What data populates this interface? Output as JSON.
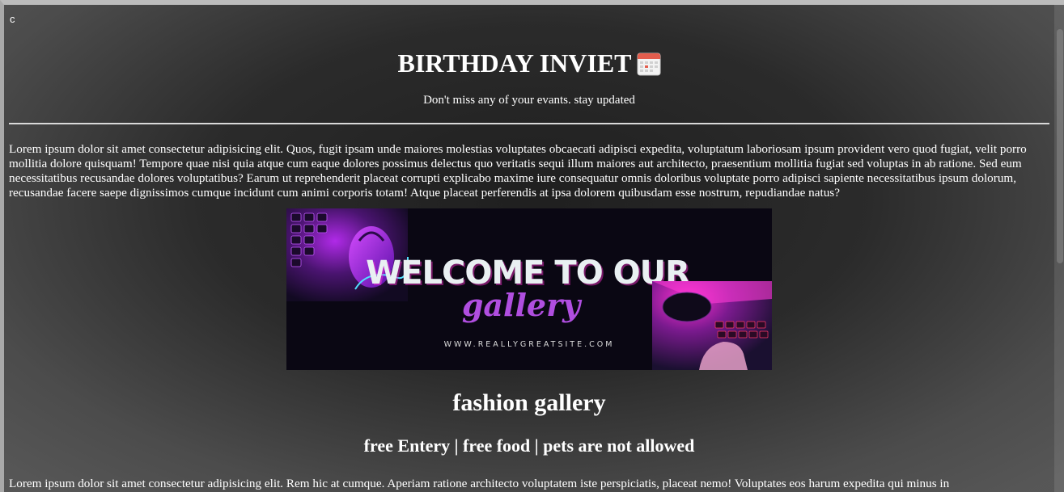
{
  "corner": {
    "letter": "c"
  },
  "header": {
    "title": "BIRTHDAY INVIET",
    "calendar_icon": "calendar-icon",
    "tagline": "Don't miss any of your evants. stay updated"
  },
  "intro": {
    "text": "Lorem ipsum dolor sit amet consectetur adipisicing elit. Quos, fugit ipsam unde maiores molestias voluptates obcaecati adipisci expedita, voluptatum laboriosam ipsum provident vero quod fugiat, velit porro mollitia dolore quisquam! Tempore quae nisi quia atque cum eaque dolores possimus delectus quo veritatis sequi illum maiores aut architecto, praesentium mollitia fugiat sed voluptas in ab ratione. Sed eum necessitatibus recusandae dolores voluptatibus? Earum ut reprehenderit placeat corrupti explicabo maxime iure consequatur omnis doloribus voluptate porro adipisci sapiente necessitatibus ipsum dolorum, recusandae facere saepe dignissimos cumque incidunt cum animi corporis totam! Atque placeat perferendis at ipsa dolorem quibusdam esse nostrum, repudiandae natus?"
  },
  "banner": {
    "headline": "WELCOME TO OUR",
    "script_word": "gallery",
    "website": "WWW.REALLYGREATSITE.COM",
    "colors": {
      "background": "#0a0713",
      "headline": "#e9f0f2",
      "script": "#b04ee0",
      "accent": "#e62bd8"
    }
  },
  "gallery": {
    "title": "fashion gallery",
    "info": "free Entery | free food | pets are not allowed"
  },
  "outro": {
    "text": "Lorem ipsum dolor sit amet consectetur adipisicing elit. Rem hic at cumque. Aperiam ratione architecto voluptatem iste perspiciatis, placeat nemo! Voluptates eos harum expedita qui minus in"
  }
}
